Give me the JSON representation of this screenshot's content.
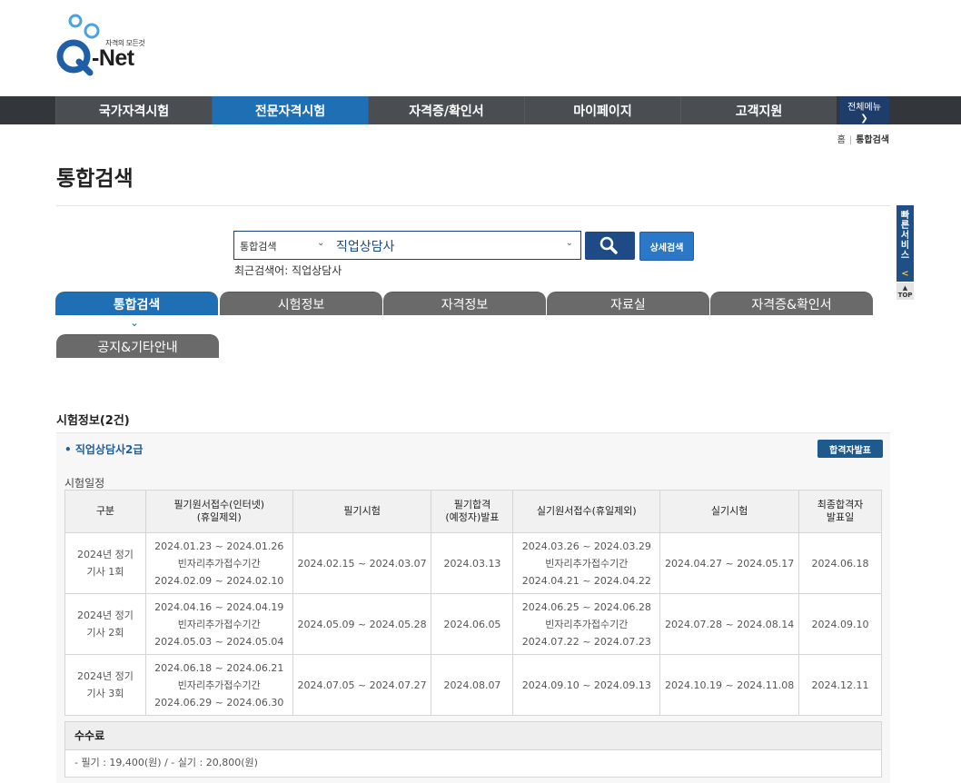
{
  "logo": {
    "tagline": "자격의 모든것",
    "name": "-Net"
  },
  "nav": {
    "items": [
      {
        "label": "국가자격시험"
      },
      {
        "label": "전문자격시험"
      },
      {
        "label": "자격증/확인서"
      },
      {
        "label": "마이페이지"
      },
      {
        "label": "고객지원"
      }
    ],
    "all_menu": "전체메뉴"
  },
  "breadcrumb": {
    "home": "홈",
    "current": "통합검색"
  },
  "page_title": "통합검색",
  "search": {
    "scope": "통합검색",
    "query": "직업상담사",
    "detail_label": "상세검색",
    "recent": "최근검색어: 직업상담사"
  },
  "tabs": [
    "통합검색",
    "시험정보",
    "자격정보",
    "자료실",
    "자격증&확인서",
    "공지&기타안내"
  ],
  "exam": {
    "section_title": "시험정보(2건)",
    "name": "• 직업상담사2급",
    "pass_button": "합격자발표",
    "schedule_label": "시험일정",
    "headers": [
      "구분",
      "필기원서접수(인터넷)\n(휴일제외)",
      "필기시험",
      "필기합격\n(예정자)발표",
      "실기원서접수(휴일제외)",
      "실기시험",
      "최종합격자\n발표일"
    ],
    "rows": [
      [
        "2024년 정기\n기사 1회",
        "2024.01.23 ~ 2024.01.26\n빈자리추가접수기간\n2024.02.09 ~ 2024.02.10",
        "2024.02.15 ~ 2024.03.07",
        "2024.03.13",
        "2024.03.26 ~ 2024.03.29\n빈자리추가접수기간\n2024.04.21 ~ 2024.04.22",
        "2024.04.27 ~ 2024.05.17",
        "2024.06.18"
      ],
      [
        "2024년 정기\n기사 2회",
        "2024.04.16 ~ 2024.04.19\n빈자리추가접수기간\n2024.05.03 ~ 2024.05.04",
        "2024.05.09 ~ 2024.05.28",
        "2024.06.05",
        "2024.06.25 ~ 2024.06.28\n빈자리추가접수기간\n2024.07.22 ~ 2024.07.23",
        "2024.07.28 ~ 2024.08.14",
        "2024.09.10"
      ],
      [
        "2024년 정기\n기사 3회",
        "2024.06.18 ~ 2024.06.21\n빈자리추가접수기간\n2024.06.29 ~ 2024.06.30",
        "2024.07.05 ~ 2024.07.27",
        "2024.08.07",
        "2024.09.10 ~ 2024.09.13",
        "2024.10.19 ~ 2024.11.08",
        "2024.12.11"
      ]
    ],
    "fee_title": "수수료",
    "fee_text": "- 필기 : 19,400(원) / - 실기 : 20,800(원)"
  },
  "quick": {
    "label": "빠른서비스",
    "top": "TOP"
  },
  "colors": {
    "primary": "#1f6fb5",
    "nav_bg": "#33363b",
    "dark_blue": "#1e4b85"
  }
}
